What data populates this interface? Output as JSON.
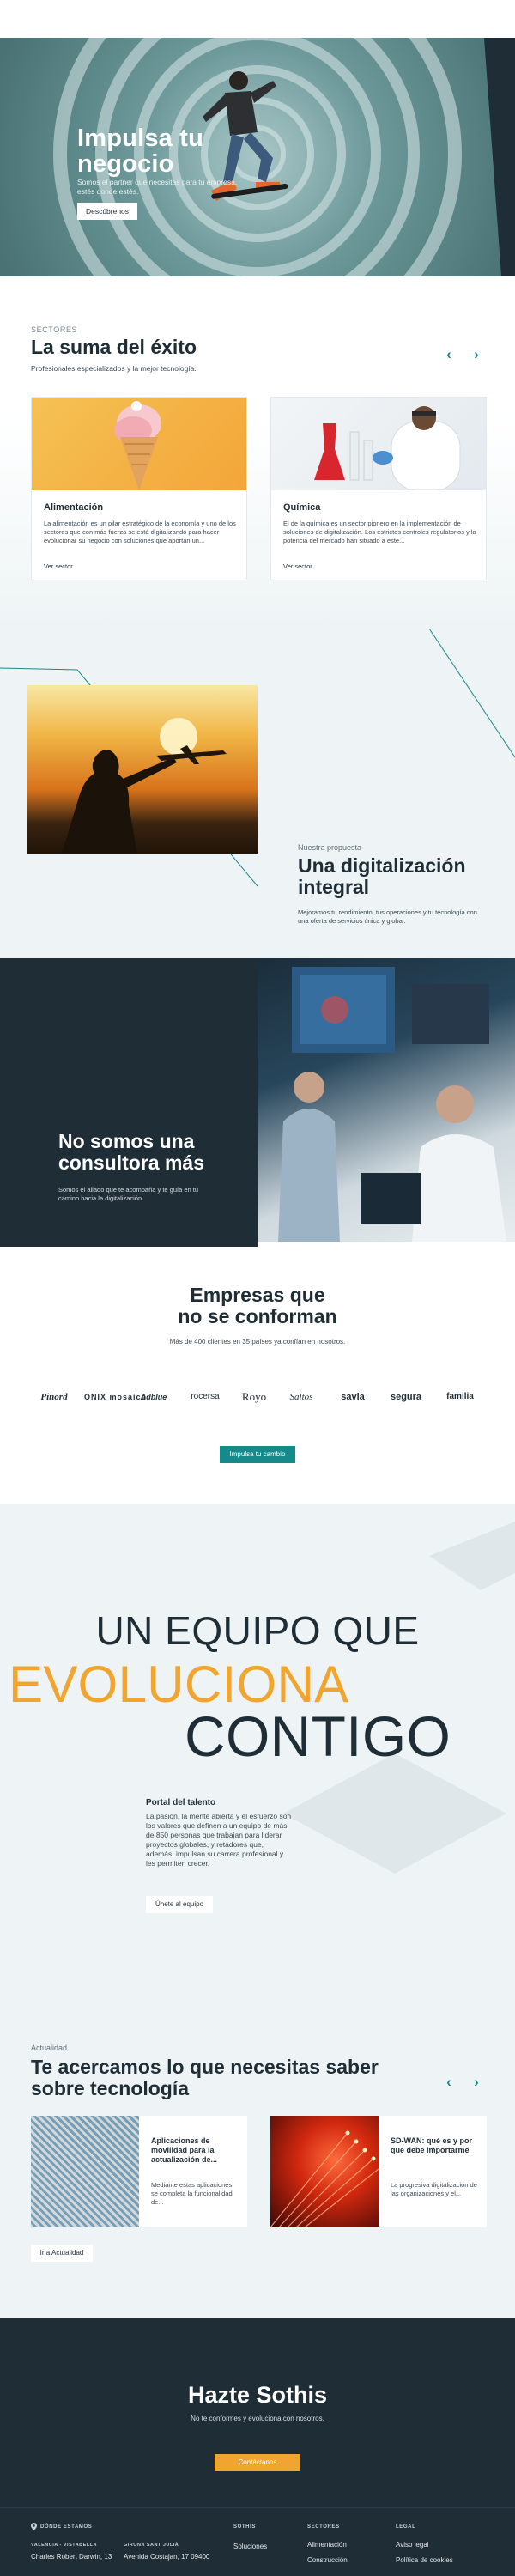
{
  "hero": {
    "title": "Impulsa tu negocio",
    "subtitle": "Somos el partner que necesitas para tu empresa, estés donde estés.",
    "cta": "Descúbrenos"
  },
  "sectors": {
    "eyebrow": "SECTORES",
    "title": "La suma del éxito",
    "subtitle": "Profesionales especializados y la mejor tecnología.",
    "prev_icon": "‹",
    "next_icon": "›",
    "cards": [
      {
        "title": "Alimentación",
        "text": "La alimentación es un pilar estratégico de la economía y uno de los sectores que con más fuerza se está digitalizando para hacer evolucionar su negocio con soluciones que aportan un...",
        "link": "Ver sector"
      },
      {
        "title": "Química",
        "text": "El de la química es un sector pionero en la implementación de soluciones de digitalización. Los estrictos controles regulatorios y la potencia del mercado han situado a este...",
        "link": "Ver sector"
      }
    ]
  },
  "proposal": {
    "eyebrow": "Nuestra propuesta",
    "title": "Una digitalización integral",
    "text": "Mejoramos tu rendimiento, tus operaciones y tu tecnología con una oferta de servicios única y global."
  },
  "consult": {
    "title": "No somos una consultora más",
    "text": "Somos el aliado que te acompaña y te guía en tu camino hacia la digitalización."
  },
  "clients": {
    "title_line1": "Empresas que",
    "title_line2": "no se conforman",
    "subtitle": "Más de 400 clientes en 35 países ya confían en nosotros.",
    "logos": [
      "Pinord",
      "ONIX mosaico",
      "Adblue",
      "rocersa",
      "Royo",
      "Saltos",
      "savia",
      "segura",
      "familia"
    ],
    "cta": "Impulsa tu cambio"
  },
  "team": {
    "line1": "UN EQUIPO QUE",
    "line2": "EVOLUCIONA",
    "line3": "CONTIGO",
    "subtitle": "Portal del talento",
    "text": "La pasión, la mente abierta y el esfuerzo son los valores que definen a un equipo de más de 850 personas que trabajan para liderar proyectos globales, y retadores que, además, impulsan su carrera profesional y les permiten crecer.",
    "cta": "Únete al equipo",
    "accent": "#f0a531"
  },
  "news": {
    "eyebrow": "Actualidad",
    "title": "Te acercamos lo que necesitas saber sobre tecnología",
    "prev_icon": "‹",
    "next_icon": "›",
    "cards": [
      {
        "title": "Aplicaciones de movilidad para la actualización de...",
        "text": "Mediante estas aplicaciones se completa la funcionalidad de..."
      },
      {
        "title": "SD-WAN: qué es y por qué debe importarme",
        "text": "La progresiva digitalización de las organizaciones y el..."
      }
    ],
    "cta": "Ir a Actualidad"
  },
  "cta": {
    "title": "Hazte Sothis",
    "subtitle": "No te conformes y evoluciona con nosotros.",
    "button": "Contáctanos"
  },
  "footer": {
    "location_heading": "DÓNDE ESTAMOS",
    "location_icon": "pin-icon",
    "office1_label": "VALENCIA - VISTABELLA",
    "office1_address": "Charles Robert Darwin, 13",
    "office2_label": "GIRONA SANT JULIÀ",
    "office2_address": "Avenida Costajan, 17 09400",
    "col_sothis": "SOTHIS",
    "col_sothis_item": "Soluciones",
    "col_sectors": "SECTORES",
    "col_sectors_item1": "Alimentación",
    "col_sectors_item2": "Construcción",
    "col_legal": "LEGAL",
    "col_legal_item1": "Aviso legal",
    "col_legal_item2": "Política de cookies"
  },
  "colors": {
    "brand_dark": "#1f2d36",
    "teal": "#16898a",
    "orange": "#f0a531",
    "light_bg": "#eef3f5"
  }
}
